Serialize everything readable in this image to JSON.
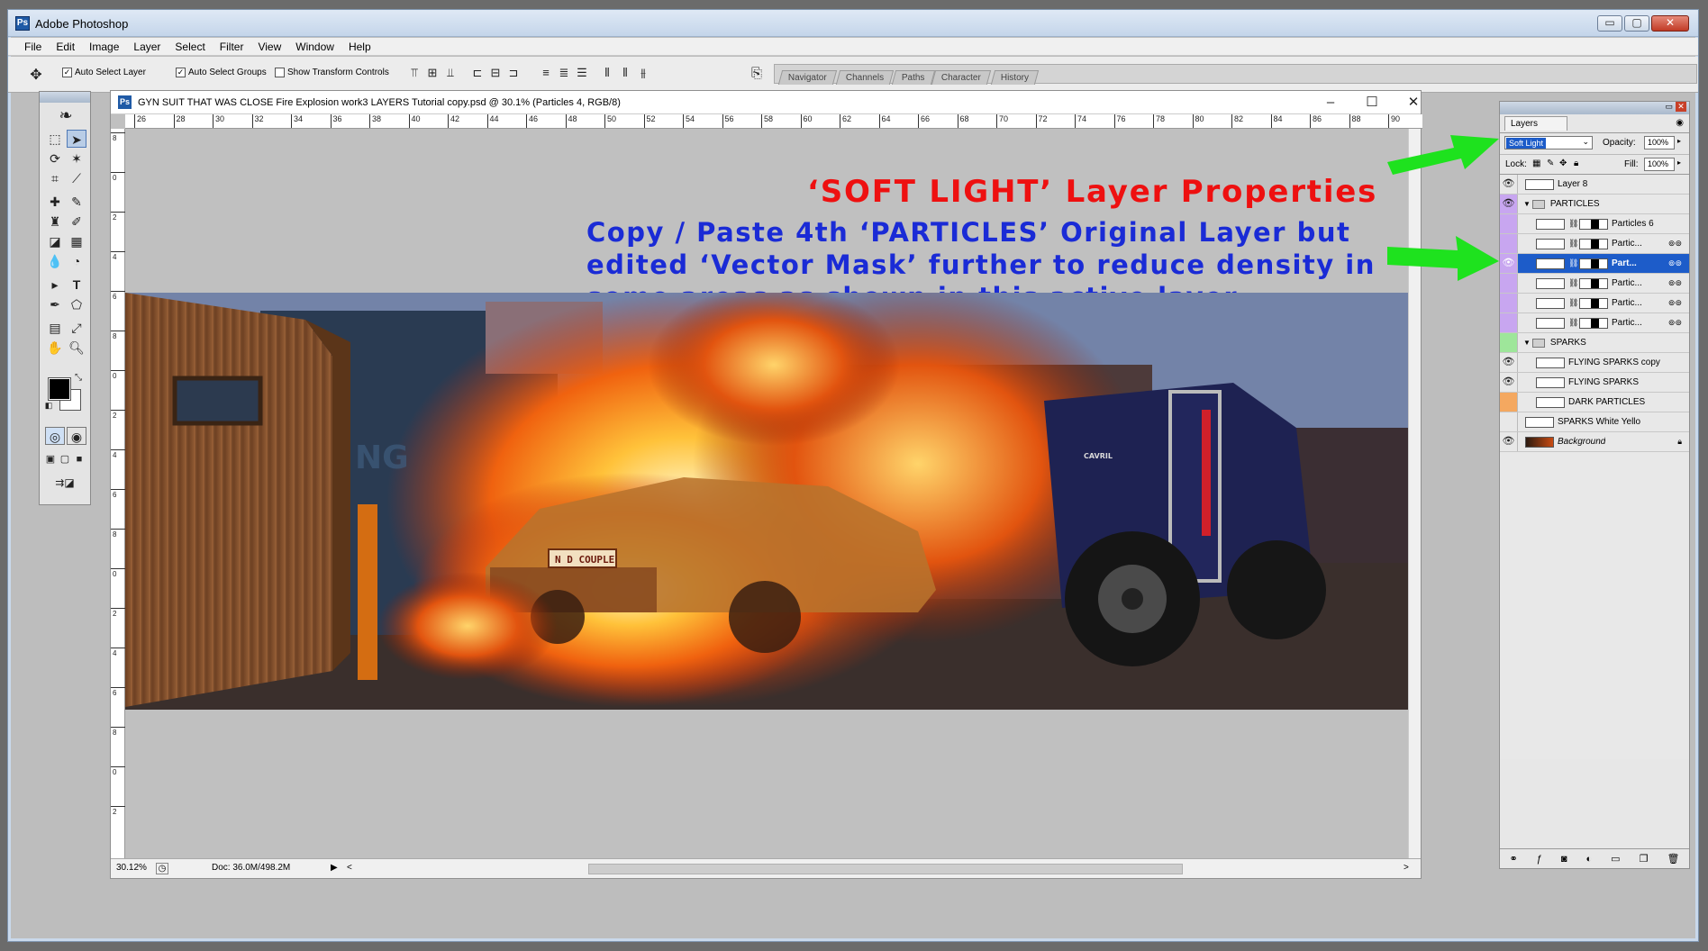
{
  "app": {
    "title": "Adobe Photoshop",
    "logo": "Ps",
    "win_min": "▭",
    "win_max": "▢",
    "win_close": "✕"
  },
  "menu": [
    "File",
    "Edit",
    "Image",
    "Layer",
    "Select",
    "Filter",
    "View",
    "Window",
    "Help"
  ],
  "options": {
    "auto_select_layer": "Auto Select Layer",
    "auto_select_groups": "Auto Select Groups",
    "show_transform": "Show Transform Controls",
    "auto_select_layer_checked": true,
    "auto_select_groups_checked": true,
    "show_transform_checked": false
  },
  "well_tabs": [
    "Navigator",
    "Channels",
    "Paths",
    "Character",
    "History"
  ],
  "document": {
    "icon": "Ps",
    "title": "GYN SUIT THAT WAS CLOSE Fire Explosion work3 LAYERS Tutorial copy.psd @ 30.1% (Particles 4, RGB/8)",
    "min": "–",
    "max": "☐",
    "close": "✕",
    "ruler_h": [
      "26",
      "28",
      "30",
      "32",
      "34",
      "36",
      "38",
      "40",
      "42",
      "44",
      "46",
      "48",
      "50",
      "52",
      "54",
      "56",
      "58",
      "60",
      "62",
      "64",
      "66",
      "68",
      "70",
      "72",
      "74",
      "76",
      "78",
      "80",
      "82",
      "84",
      "86",
      "88",
      "90"
    ],
    "ruler_v": [
      "8",
      "0",
      "2",
      "4",
      "6",
      "8",
      "0",
      "2",
      "4",
      "6",
      "8",
      "0",
      "2",
      "4",
      "6",
      "8",
      "0",
      "2"
    ],
    "zoom": "30.12%",
    "doc_size": "Doc: 36.0M/498.2M",
    "plate_text": "N D COUPLE",
    "truck_text": "CAVRIL",
    "trailer_text": "NG",
    "status_arrow": "▶",
    "scroll_left": "<",
    "scroll_right": ">"
  },
  "annotations": {
    "title": "‘SOFT LIGHT’ Layer Properties",
    "line1": "Copy / Paste 4th ‘PARTICLES’ Original Layer but",
    "line2": "edited ‘Vector Mask’ further to reduce density in",
    "line3": "some areas as shown in this active layer",
    "title_color": "#ee1010",
    "body_color": "#1a2bd6",
    "arrow_color": "#1ee21e"
  },
  "layers_panel": {
    "tab": "Layers",
    "blend_mode": "Soft Light",
    "opacity_label": "Opacity:",
    "opacity": "100%",
    "lock_label": "Lock:",
    "fill_label": "Fill:",
    "fill": "100%",
    "rows": [
      {
        "name": "Layer 8",
        "visible": true,
        "type": "layer",
        "indent": 0,
        "color": ""
      },
      {
        "name": "PARTICLES",
        "visible": true,
        "type": "group",
        "indent": 0,
        "color": "#c8a6f0"
      },
      {
        "name": "Particles 6",
        "visible": false,
        "type": "masked",
        "indent": 1,
        "color": "#c8a6f0"
      },
      {
        "name": "Partic...",
        "visible": false,
        "type": "masked",
        "indent": 1,
        "color": "#c8a6f0"
      },
      {
        "name": "Part...",
        "visible": true,
        "type": "masked",
        "indent": 1,
        "color": "#c8a6f0",
        "active": true
      },
      {
        "name": "Partic...",
        "visible": false,
        "type": "masked",
        "indent": 1,
        "color": "#c8a6f0"
      },
      {
        "name": "Partic...",
        "visible": false,
        "type": "masked",
        "indent": 1,
        "color": "#c8a6f0"
      },
      {
        "name": "Partic...",
        "visible": false,
        "type": "masked",
        "indent": 1,
        "color": "#c8a6f0"
      },
      {
        "name": "SPARKS",
        "visible": false,
        "type": "group",
        "indent": 0,
        "color": "#9ee69a"
      },
      {
        "name": "FLYING SPARKS copy",
        "visible": true,
        "type": "layer",
        "indent": 1,
        "color": ""
      },
      {
        "name": "FLYING SPARKS",
        "visible": true,
        "type": "layer",
        "indent": 1,
        "color": ""
      },
      {
        "name": "DARK PARTICLES",
        "visible": false,
        "type": "layer",
        "indent": 1,
        "color": "#f4a860"
      },
      {
        "name": "SPARKS White Yello",
        "visible": false,
        "type": "layer",
        "indent": 0,
        "color": ""
      },
      {
        "name": "Background",
        "visible": true,
        "type": "background",
        "indent": 0,
        "color": ""
      }
    ],
    "bottom_icons": [
      "link-icon",
      "fx-icon",
      "mask-icon",
      "adjustment-icon",
      "group-icon",
      "new-layer-icon",
      "trash-icon"
    ]
  }
}
